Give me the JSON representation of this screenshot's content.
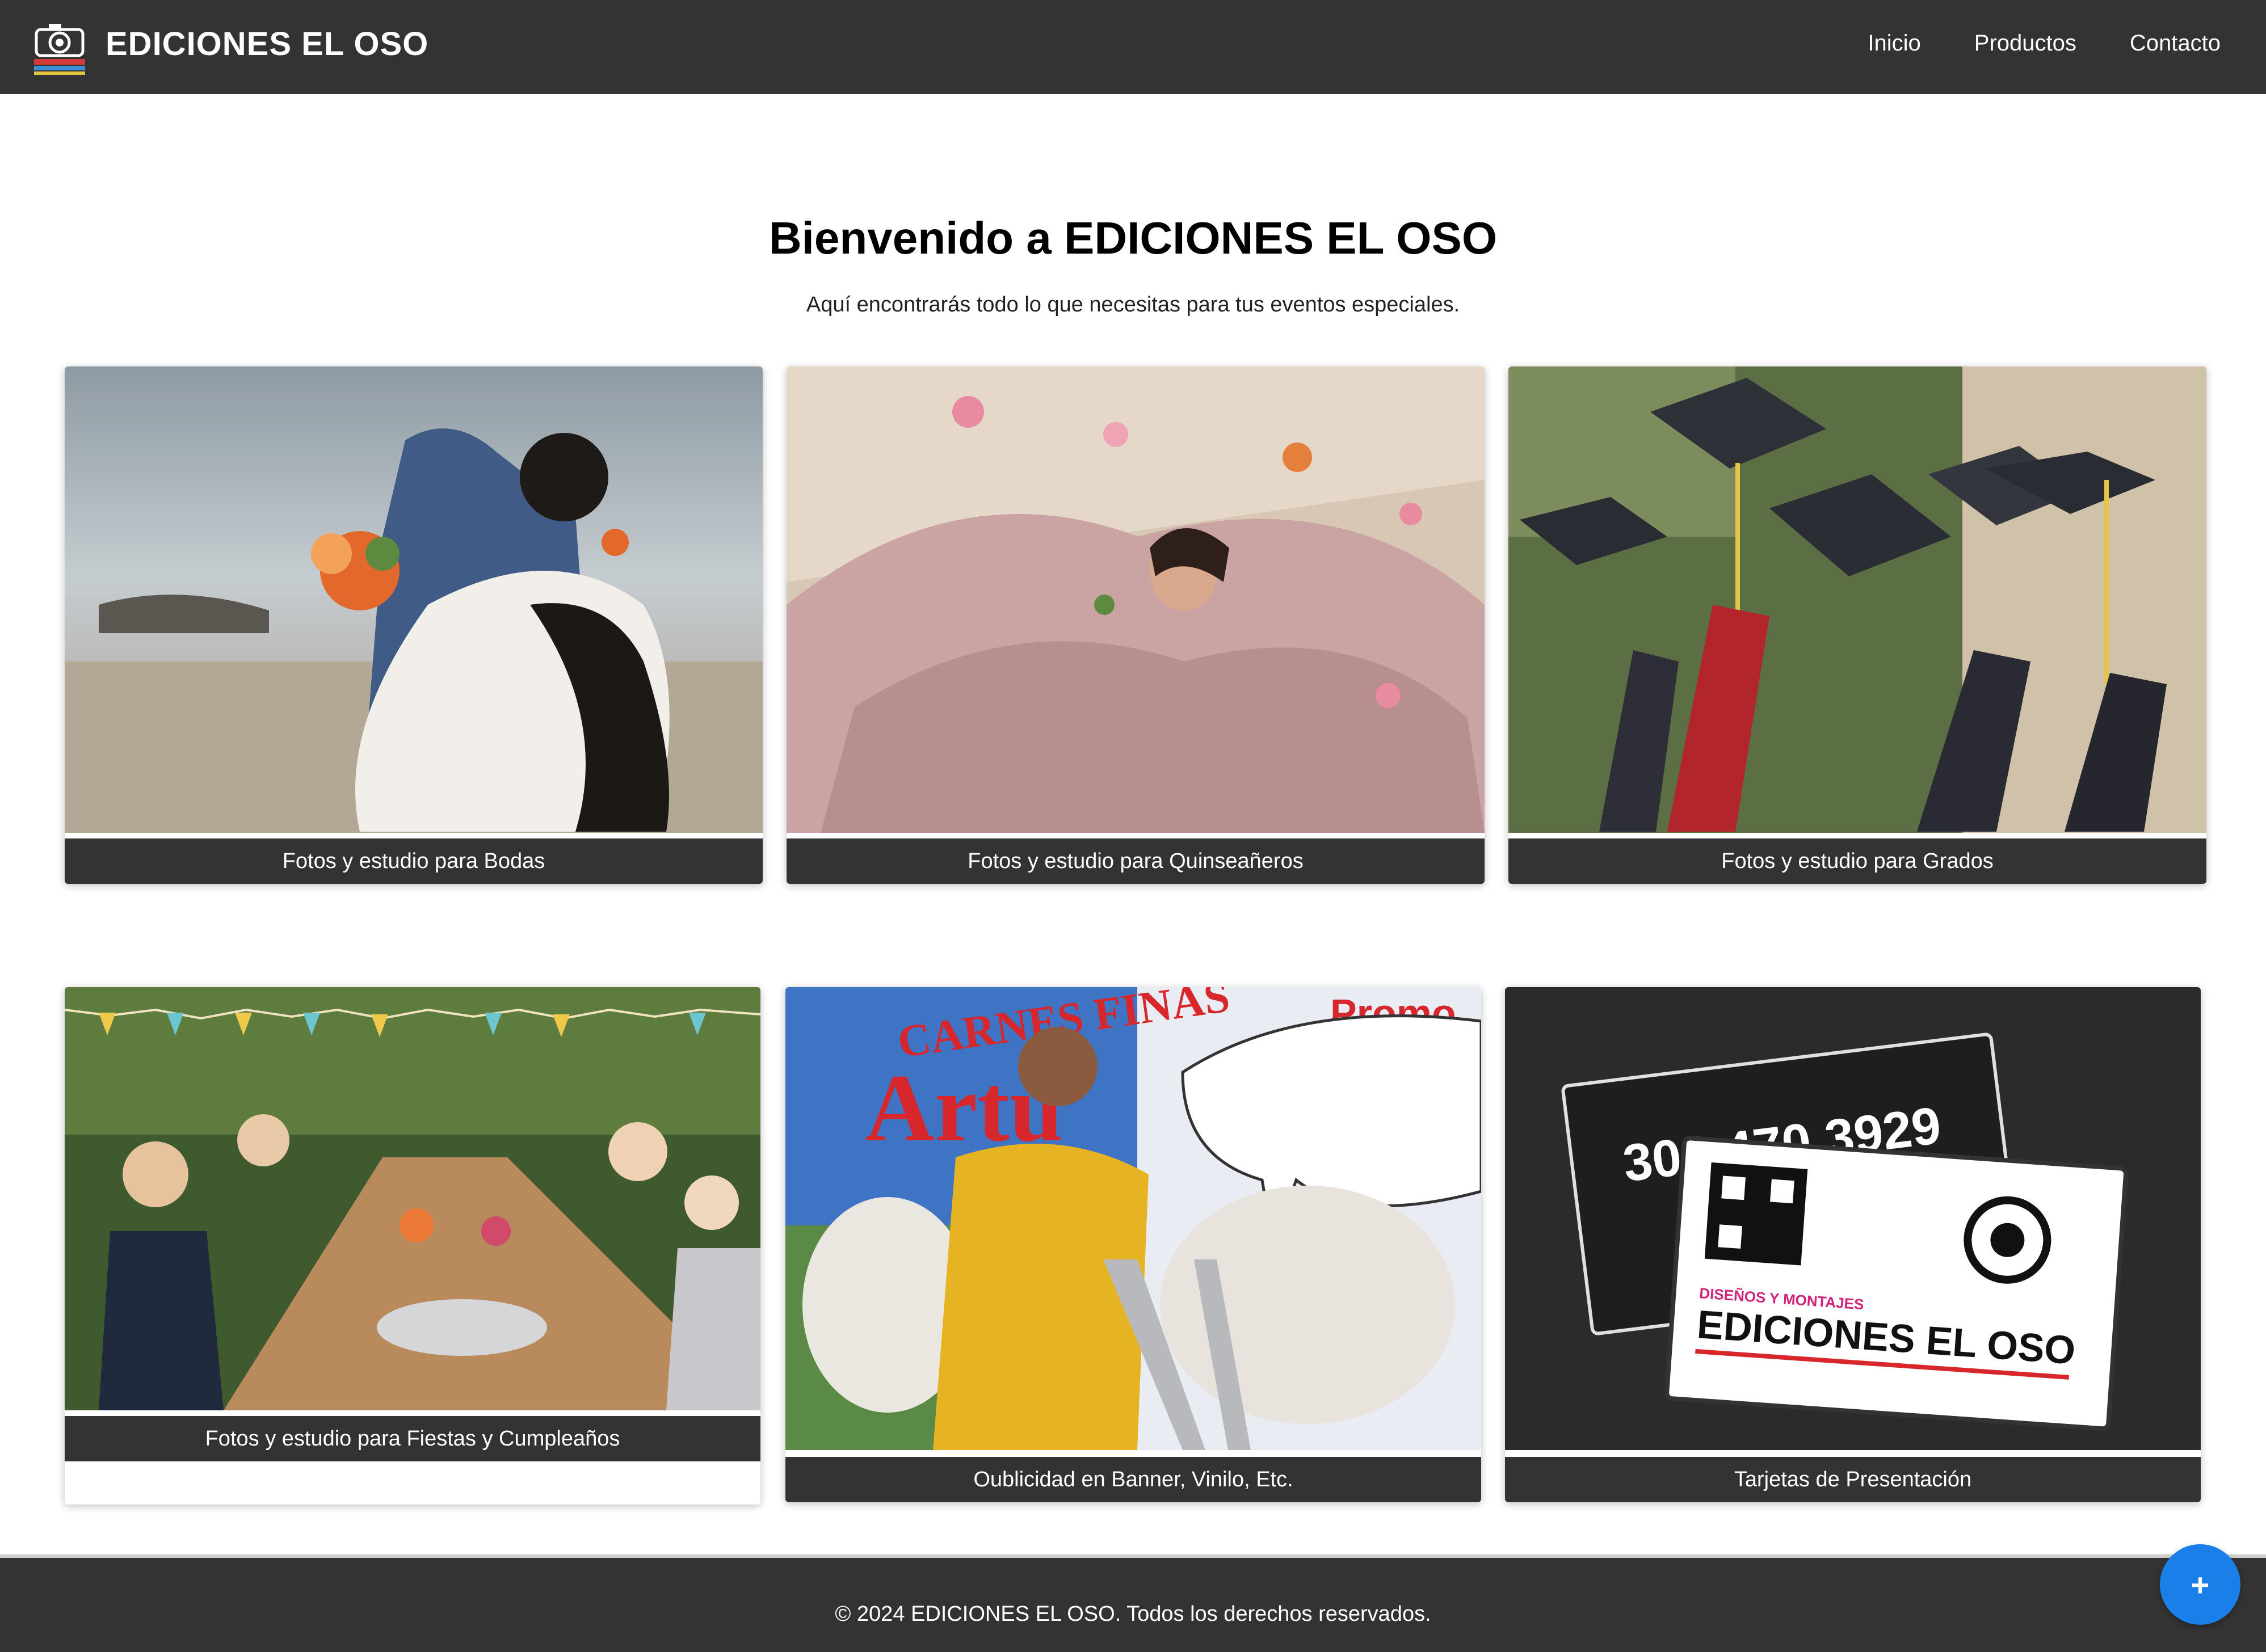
{
  "header": {
    "brand": "EDICIONES EL OSO",
    "nav": [
      "Inicio",
      "Productos",
      "Contacto"
    ]
  },
  "hero": {
    "title": "Bienvenido a EDICIONES EL OSO",
    "subtitle": "Aquí encontrarás todo lo que necesitas para tus eventos especiales."
  },
  "cards": [
    {
      "caption": "Fotos y estudio para Bodas",
      "image": "wedding-couple-beach-photo"
    },
    {
      "caption": "Fotos y estudio para Quinseañeros",
      "image": "quinceanera-pink-dress-photo"
    },
    {
      "caption": "Fotos y estudio para Grados",
      "image": "graduation-caps-photo"
    },
    {
      "caption": "Fotos y estudio para Fiestas y Cumpleaños",
      "image": "kids-birthday-party-photo"
    },
    {
      "caption": "Oublicidad en Banner, Vinilo, Etc.",
      "image": "banner-painting-photo"
    },
    {
      "caption": "Tarjetas de Presentación",
      "image": "business-cards-photo"
    }
  ],
  "business_card": {
    "phone": "300 470 3929",
    "brand_line": "EDICIONES EL OSO",
    "tagline": "DISEÑOS Y MONTAJES"
  },
  "banner_text": {
    "line1": "CARNES FINAS",
    "line2": "Artu",
    "promo": "Promo"
  },
  "footer": {
    "text": "© 2024 EDICIONES EL OSO. Todos los derechos reservados."
  },
  "fab": {
    "label": "+"
  },
  "colors": {
    "dark_bar": "#333333",
    "fab": "#1a7fe8"
  }
}
